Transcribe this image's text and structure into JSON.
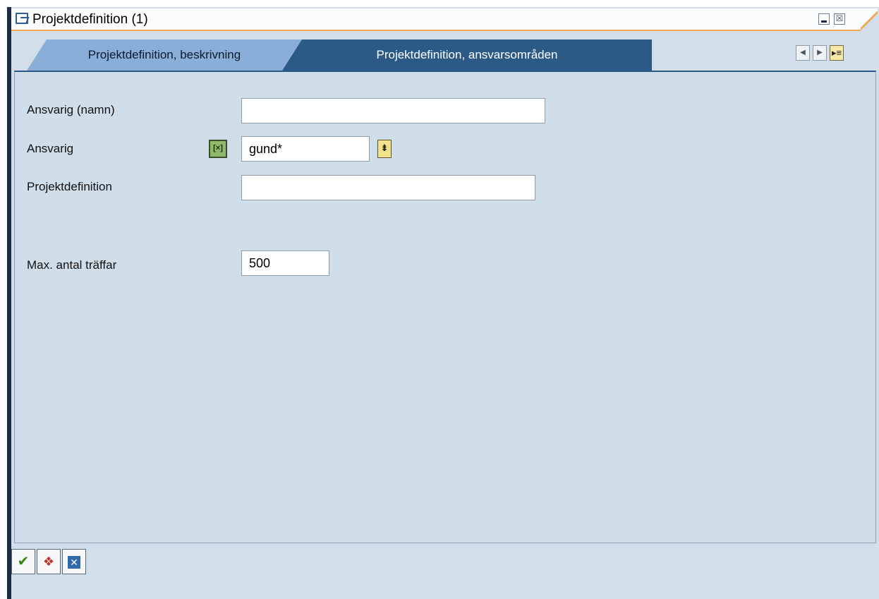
{
  "window": {
    "title": "Projektdefinition (1)",
    "minimize_label": "",
    "close_label": "☒"
  },
  "tabs": [
    {
      "label": "Projektdefinition, beskrivning",
      "active": false
    },
    {
      "label": "Projektdefinition, ansvarsområden",
      "active": true
    }
  ],
  "tab_nav": {
    "prev": "◀",
    "next": "▶",
    "list": "▸≡"
  },
  "form": {
    "responsible_name": {
      "label": "Ansvarig (namn)",
      "value": ""
    },
    "responsible": {
      "label": "Ansvarig",
      "value": "gund*",
      "select_option_icon": "[×]",
      "value_help_icon": "⇟"
    },
    "project_definition": {
      "label": "Projektdefinition",
      "value": ""
    },
    "max_hits": {
      "label": "Max. antal träffar",
      "value": "500"
    }
  },
  "toolbar": {
    "continue_icon": "✔",
    "multiple_selection_icon": "❖",
    "cancel_icon": "✕"
  },
  "colors": {
    "active_tab": "#2c5a86",
    "inactive_tab": "#89aed7",
    "panel_background": "#d0deea",
    "title_accent": "#efa84f"
  }
}
